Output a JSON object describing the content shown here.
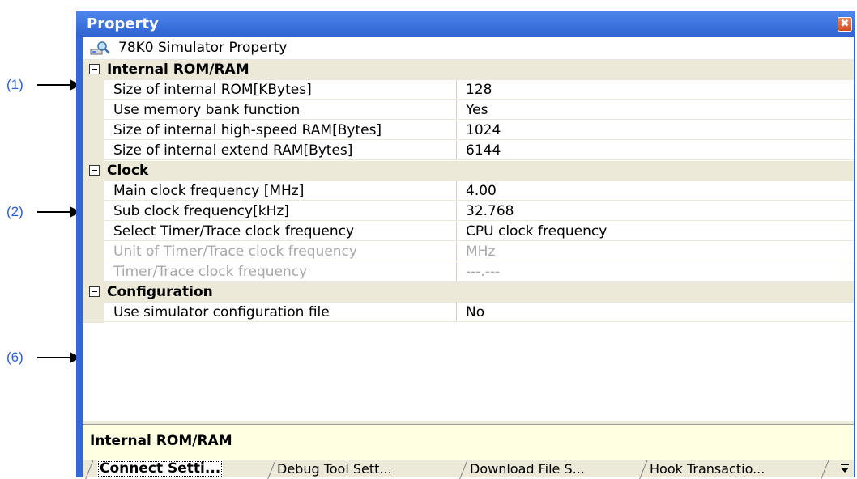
{
  "callouts": [
    {
      "label": "(1)"
    },
    {
      "label": "(2)"
    },
    {
      "label": "(6)"
    }
  ],
  "window": {
    "title": "Property",
    "close_glyph": "✖",
    "header": {
      "icon": "property-icon",
      "text": "78K0 Simulator Property"
    }
  },
  "categories": [
    {
      "label": "Internal ROM/RAM",
      "expanded": true,
      "rows": [
        {
          "name": "Size of internal ROM[KBytes]",
          "value": "128",
          "enabled": true
        },
        {
          "name": "Use memory bank function",
          "value": "Yes",
          "enabled": true
        },
        {
          "name": "Size of internal high-speed RAM[Bytes]",
          "value": "1024",
          "enabled": true
        },
        {
          "name": "Size of internal extend RAM[Bytes]",
          "value": "6144",
          "enabled": true
        }
      ]
    },
    {
      "label": "Clock",
      "expanded": true,
      "rows": [
        {
          "name": "Main clock frequency [MHz]",
          "value": "4.00",
          "enabled": true
        },
        {
          "name": "Sub clock frequency[kHz]",
          "value": "32.768",
          "enabled": true
        },
        {
          "name": "Select Timer/Trace clock frequency",
          "value": "CPU clock frequency",
          "enabled": true
        },
        {
          "name": "Unit of Timer/Trace clock frequency",
          "value": "MHz",
          "enabled": false
        },
        {
          "name": "Timer/Trace clock frequency",
          "value": "---.---",
          "enabled": false
        }
      ]
    },
    {
      "label": "Configuration",
      "expanded": true,
      "rows": [
        {
          "name": "Use simulator configuration file",
          "value": "No",
          "enabled": true
        }
      ]
    }
  ],
  "description": {
    "text": "Internal ROM/RAM"
  },
  "tabs": [
    {
      "label": "Connect Setti...",
      "active": true
    },
    {
      "label": "Debug Tool Sett...",
      "active": false
    },
    {
      "label": "Download File S...",
      "active": false
    },
    {
      "label": "Hook Transactio...",
      "active": false
    }
  ],
  "colors": {
    "titlebar": "#2d62d0",
    "category_bg": "#ece9d8",
    "description_bg": "#ffffe1",
    "disabled_text": "#a8a8a8",
    "callout_text": "#2b5fd8"
  }
}
